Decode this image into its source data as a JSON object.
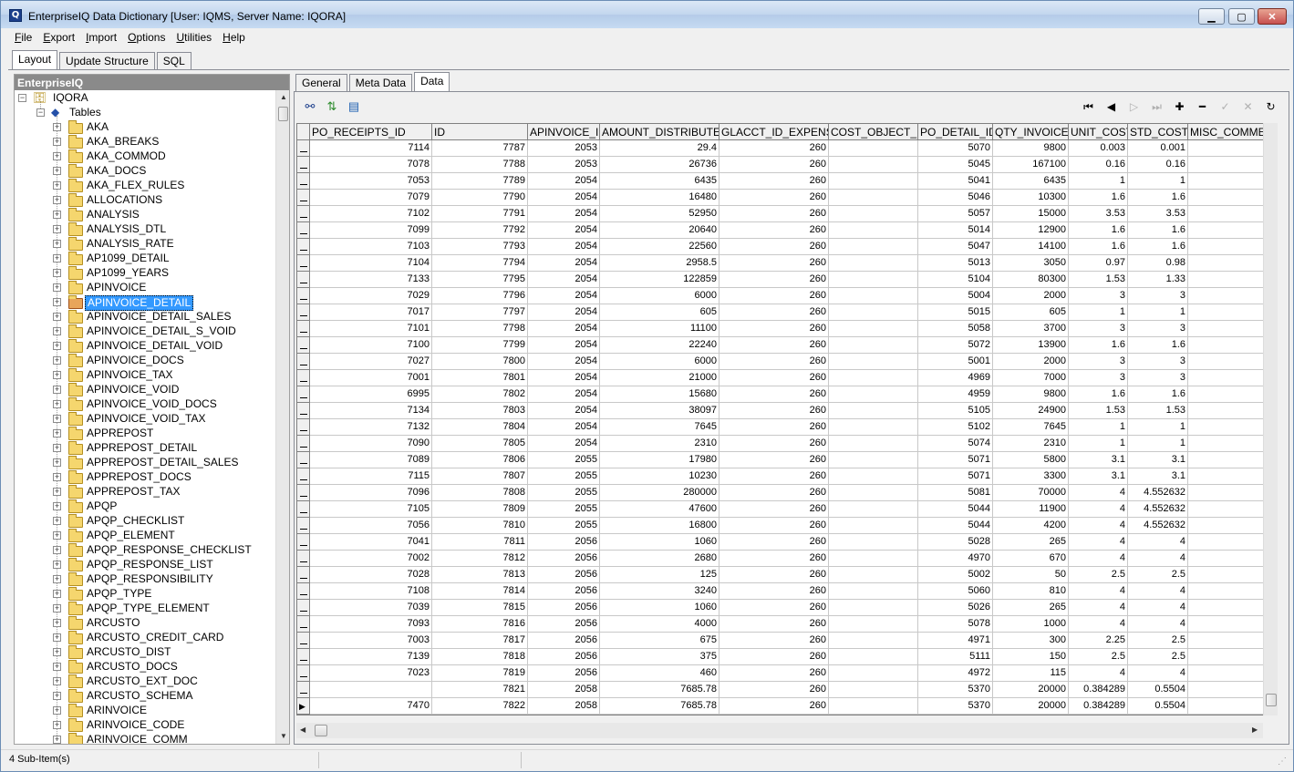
{
  "window": {
    "title": "EnterpriseIQ Data Dictionary [User: IQMS, Server Name: IQORA]"
  },
  "menu": [
    "File",
    "Export",
    "Import",
    "Options",
    "Utilities",
    "Help"
  ],
  "top_tabs": [
    "Layout",
    "Update Structure",
    "SQL"
  ],
  "left_panel": {
    "header": "EnterpriseIQ",
    "root": "IQORA",
    "tables_node": "Tables",
    "selected": "APINVOICE_DETAIL",
    "items": [
      "AKA",
      "AKA_BREAKS",
      "AKA_COMMOD",
      "AKA_DOCS",
      "AKA_FLEX_RULES",
      "ALLOCATIONS",
      "ANALYSIS",
      "ANALYSIS_DTL",
      "ANALYSIS_RATE",
      "AP1099_DETAIL",
      "AP1099_YEARS",
      "APINVOICE",
      "APINVOICE_DETAIL",
      "APINVOICE_DETAIL_SALES",
      "APINVOICE_DETAIL_S_VOID",
      "APINVOICE_DETAIL_VOID",
      "APINVOICE_DOCS",
      "APINVOICE_TAX",
      "APINVOICE_VOID",
      "APINVOICE_VOID_DOCS",
      "APINVOICE_VOID_TAX",
      "APPREPOST",
      "APPREPOST_DETAIL",
      "APPREPOST_DETAIL_SALES",
      "APPREPOST_DOCS",
      "APPREPOST_TAX",
      "APQP",
      "APQP_CHECKLIST",
      "APQP_ELEMENT",
      "APQP_RESPONSE_CHECKLIST",
      "APQP_RESPONSE_LIST",
      "APQP_RESPONSIBILITY",
      "APQP_TYPE",
      "APQP_TYPE_ELEMENT",
      "ARCUSTO",
      "ARCUSTO_CREDIT_CARD",
      "ARCUSTO_DIST",
      "ARCUSTO_DOCS",
      "ARCUSTO_EXT_DOC",
      "ARCUSTO_SCHEMA",
      "ARINVOICE",
      "ARINVOICE_CODE",
      "ARINVOICE_COMM"
    ]
  },
  "right_tabs": [
    "General",
    "Meta Data",
    "Data"
  ],
  "grid": {
    "columns": [
      "PO_RECEIPTS_ID",
      "ID",
      "APINVOICE_ID",
      "AMOUNT_DISTRIBUTED",
      "GLACCT_ID_EXPENSE",
      "COST_OBJECT_ID",
      "PO_DETAIL_ID",
      "QTY_INVOICED",
      "UNIT_COST",
      "STD_COST",
      "MISC_COMMEN"
    ],
    "rows": [
      [
        "7114",
        "7787",
        "2053",
        "29.4",
        "260",
        "",
        "5070",
        "9800",
        "0.003",
        "0.001",
        ""
      ],
      [
        "7078",
        "7788",
        "2053",
        "26736",
        "260",
        "",
        "5045",
        "167100",
        "0.16",
        "0.16",
        ""
      ],
      [
        "7053",
        "7789",
        "2054",
        "6435",
        "260",
        "",
        "5041",
        "6435",
        "1",
        "1",
        ""
      ],
      [
        "7079",
        "7790",
        "2054",
        "16480",
        "260",
        "",
        "5046",
        "10300",
        "1.6",
        "1.6",
        ""
      ],
      [
        "7102",
        "7791",
        "2054",
        "52950",
        "260",
        "",
        "5057",
        "15000",
        "3.53",
        "3.53",
        ""
      ],
      [
        "7099",
        "7792",
        "2054",
        "20640",
        "260",
        "",
        "5014",
        "12900",
        "1.6",
        "1.6",
        ""
      ],
      [
        "7103",
        "7793",
        "2054",
        "22560",
        "260",
        "",
        "5047",
        "14100",
        "1.6",
        "1.6",
        ""
      ],
      [
        "7104",
        "7794",
        "2054",
        "2958.5",
        "260",
        "",
        "5013",
        "3050",
        "0.97",
        "0.98",
        ""
      ],
      [
        "7133",
        "7795",
        "2054",
        "122859",
        "260",
        "",
        "5104",
        "80300",
        "1.53",
        "1.33",
        ""
      ],
      [
        "7029",
        "7796",
        "2054",
        "6000",
        "260",
        "",
        "5004",
        "2000",
        "3",
        "3",
        ""
      ],
      [
        "7017",
        "7797",
        "2054",
        "605",
        "260",
        "",
        "5015",
        "605",
        "1",
        "1",
        ""
      ],
      [
        "7101",
        "7798",
        "2054",
        "11100",
        "260",
        "",
        "5058",
        "3700",
        "3",
        "3",
        ""
      ],
      [
        "7100",
        "7799",
        "2054",
        "22240",
        "260",
        "",
        "5072",
        "13900",
        "1.6",
        "1.6",
        ""
      ],
      [
        "7027",
        "7800",
        "2054",
        "6000",
        "260",
        "",
        "5001",
        "2000",
        "3",
        "3",
        ""
      ],
      [
        "7001",
        "7801",
        "2054",
        "21000",
        "260",
        "",
        "4969",
        "7000",
        "3",
        "3",
        ""
      ],
      [
        "6995",
        "7802",
        "2054",
        "15680",
        "260",
        "",
        "4959",
        "9800",
        "1.6",
        "1.6",
        ""
      ],
      [
        "7134",
        "7803",
        "2054",
        "38097",
        "260",
        "",
        "5105",
        "24900",
        "1.53",
        "1.53",
        ""
      ],
      [
        "7132",
        "7804",
        "2054",
        "7645",
        "260",
        "",
        "5102",
        "7645",
        "1",
        "1",
        ""
      ],
      [
        "7090",
        "7805",
        "2054",
        "2310",
        "260",
        "",
        "5074",
        "2310",
        "1",
        "1",
        ""
      ],
      [
        "7089",
        "7806",
        "2055",
        "17980",
        "260",
        "",
        "5071",
        "5800",
        "3.1",
        "3.1",
        ""
      ],
      [
        "7115",
        "7807",
        "2055",
        "10230",
        "260",
        "",
        "5071",
        "3300",
        "3.1",
        "3.1",
        ""
      ],
      [
        "7096",
        "7808",
        "2055",
        "280000",
        "260",
        "",
        "5081",
        "70000",
        "4",
        "4.552632",
        ""
      ],
      [
        "7105",
        "7809",
        "2055",
        "47600",
        "260",
        "",
        "5044",
        "11900",
        "4",
        "4.552632",
        ""
      ],
      [
        "7056",
        "7810",
        "2055",
        "16800",
        "260",
        "",
        "5044",
        "4200",
        "4",
        "4.552632",
        ""
      ],
      [
        "7041",
        "7811",
        "2056",
        "1060",
        "260",
        "",
        "5028",
        "265",
        "4",
        "4",
        ""
      ],
      [
        "7002",
        "7812",
        "2056",
        "2680",
        "260",
        "",
        "4970",
        "670",
        "4",
        "4",
        ""
      ],
      [
        "7028",
        "7813",
        "2056",
        "125",
        "260",
        "",
        "5002",
        "50",
        "2.5",
        "2.5",
        ""
      ],
      [
        "7108",
        "7814",
        "2056",
        "3240",
        "260",
        "",
        "5060",
        "810",
        "4",
        "4",
        ""
      ],
      [
        "7039",
        "7815",
        "2056",
        "1060",
        "260",
        "",
        "5026",
        "265",
        "4",
        "4",
        ""
      ],
      [
        "7093",
        "7816",
        "2056",
        "4000",
        "260",
        "",
        "5078",
        "1000",
        "4",
        "4",
        ""
      ],
      [
        "7003",
        "7817",
        "2056",
        "675",
        "260",
        "",
        "4971",
        "300",
        "2.25",
        "2.5",
        ""
      ],
      [
        "7139",
        "7818",
        "2056",
        "375",
        "260",
        "",
        "5111",
        "150",
        "2.5",
        "2.5",
        ""
      ],
      [
        "7023",
        "7819",
        "2056",
        "460",
        "260",
        "",
        "4972",
        "115",
        "4",
        "4",
        ""
      ],
      [
        "",
        "7821",
        "2058",
        "7685.78",
        "260",
        "",
        "5370",
        "20000",
        "0.384289",
        "0.5504",
        ""
      ],
      [
        "7470",
        "7822",
        "2058",
        "7685.78",
        "260",
        "",
        "5370",
        "20000",
        "0.384289",
        "0.5504",
        ""
      ]
    ],
    "current_row": 34
  },
  "status": {
    "text": "4 Sub-Item(s)"
  }
}
